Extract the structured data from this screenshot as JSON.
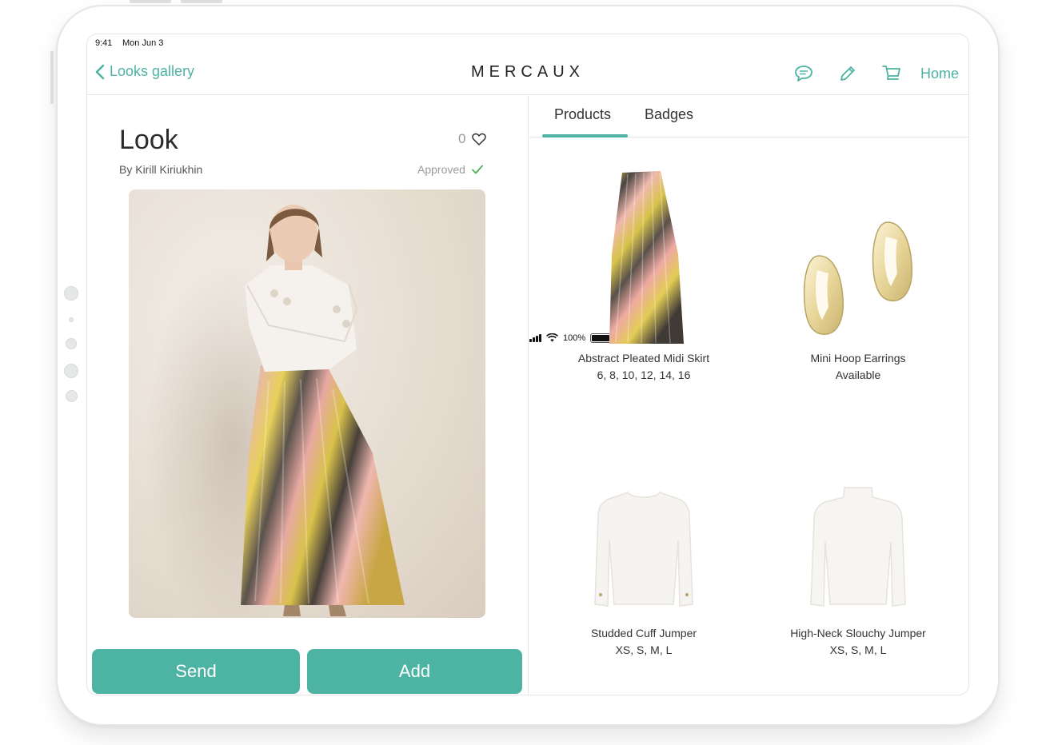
{
  "status_bar": {
    "time": "9:41",
    "date": "Mon Jun 3",
    "battery": "100%"
  },
  "nav": {
    "back_label": "Looks gallery",
    "brand": "MERCAUX",
    "home_label": "Home",
    "icons": [
      "chat-icon",
      "pencil-icon",
      "cart-icon"
    ],
    "accent_color": "#4db3a2"
  },
  "look": {
    "title": "Look",
    "likes": "0",
    "author": "By Kirill Kiriukhin",
    "status": "Approved"
  },
  "actions": {
    "send_label": "Send",
    "add_label": "Add"
  },
  "tabs": [
    {
      "label": "Products",
      "active": true
    },
    {
      "label": "Badges",
      "active": false
    }
  ],
  "products": [
    {
      "name": "Abstract Pleated Midi Skirt",
      "detail": "6, 8, 10, 12, 14, 16"
    },
    {
      "name": "Mini Hoop Earrings",
      "detail": "Available"
    },
    {
      "name": "Studded Cuff Jumper",
      "detail": "XS, S, M, L"
    },
    {
      "name": "High-Neck Slouchy Jumper",
      "detail": "XS, S, M, L"
    }
  ]
}
